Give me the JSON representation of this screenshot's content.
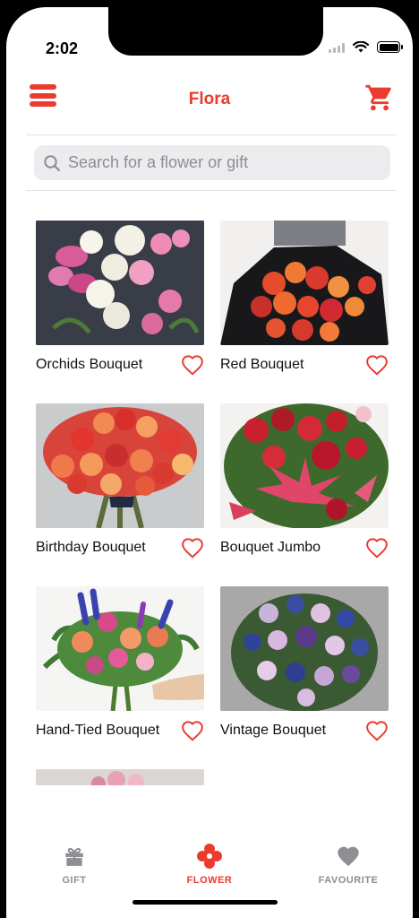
{
  "status_bar": {
    "time": "2:02"
  },
  "header": {
    "title": "Flora",
    "menu_icon": "hamburger-menu-icon",
    "cart_icon": "shopping-cart-icon"
  },
  "search": {
    "placeholder": "Search for a flower or gift",
    "icon": "search-icon"
  },
  "products": [
    {
      "name": "Orchids Bouquet",
      "favourite": false
    },
    {
      "name": "Red Bouquet",
      "favourite": false
    },
    {
      "name": "Birthday Bouquet",
      "favourite": false
    },
    {
      "name": "Bouquet Jumbo",
      "favourite": false
    },
    {
      "name": "Hand-Tied Bouquet",
      "favourite": false
    },
    {
      "name": "Vintage Bouquet",
      "favourite": false
    }
  ],
  "tabs": [
    {
      "label": "GIFT",
      "icon": "gift-icon",
      "active": false
    },
    {
      "label": "FLOWER",
      "icon": "flower-icon",
      "active": true
    },
    {
      "label": "FAVOURITE",
      "icon": "heart-icon",
      "active": false
    }
  ],
  "colors": {
    "accent": "#ea3b2e",
    "inactive_tab": "#8e8e93"
  }
}
